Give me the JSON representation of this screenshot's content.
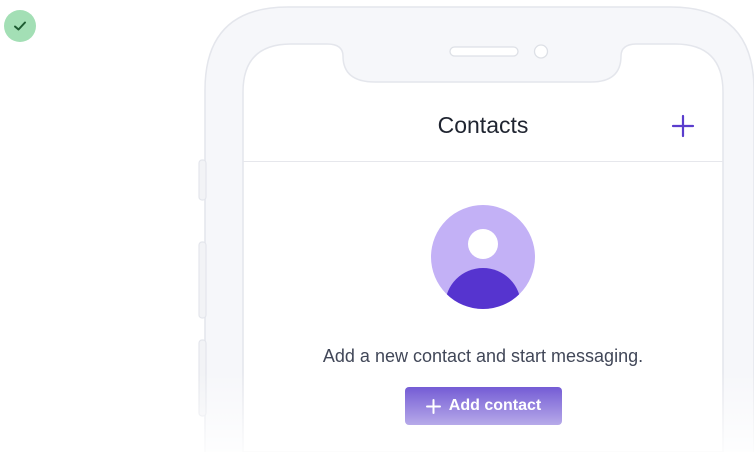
{
  "status": {
    "icon": "checkmark-icon",
    "color": "#a3dfb5"
  },
  "header": {
    "title": "Contacts",
    "add_icon": "plus-icon"
  },
  "empty_state": {
    "avatar_icon": "person-placeholder-icon",
    "message": "Add a new contact and start messaging.",
    "button_label": "Add contact",
    "button_icon": "plus-icon"
  },
  "colors": {
    "accent": "#5a3dcd",
    "avatar_bg": "#c3b1f6",
    "text_primary": "#1f2430",
    "text_secondary": "#414758"
  }
}
